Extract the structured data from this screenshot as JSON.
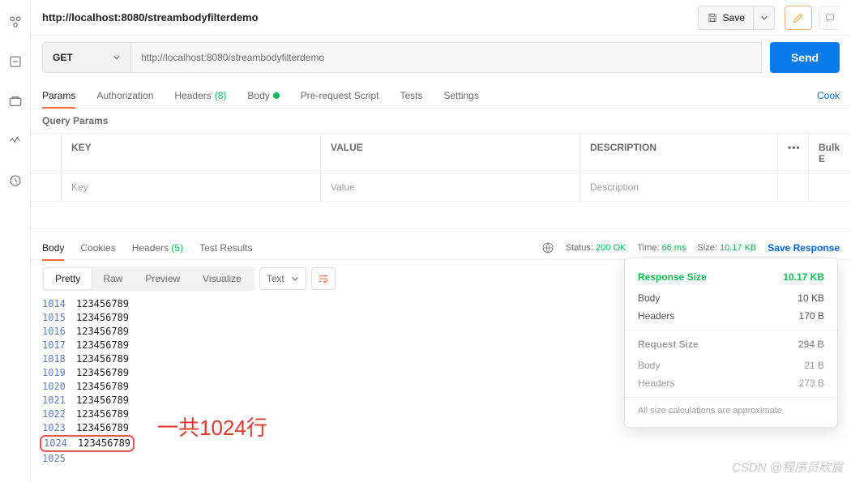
{
  "rail_icons": [
    "collections-icon",
    "api-icon",
    "env-icon",
    "monitor-icon",
    "history-icon"
  ],
  "titlebar": {
    "title": "http://localhost:8080/streambodyfilterdemo",
    "save_label": "Save"
  },
  "request": {
    "method": "GET",
    "url": "http://localhost:8080/streambodyfilterdemo",
    "send_label": "Send"
  },
  "req_tabs": {
    "params": "Params",
    "authorization": "Authorization",
    "headers": "Headers",
    "headers_count": "(8)",
    "body": "Body",
    "prerequest": "Pre-request Script",
    "tests": "Tests",
    "settings": "Settings",
    "cookies_link": "Cook"
  },
  "query_section": {
    "title": "Query Params",
    "col_key": "KEY",
    "col_value": "VALUE",
    "col_desc": "DESCRIPTION",
    "bulk": "Bulk E",
    "ph_key": "Key",
    "ph_value": "Value",
    "ph_desc": "Description"
  },
  "resp_tabs": {
    "body": "Body",
    "cookies": "Cookies",
    "headers": "Headers",
    "headers_count": "(5)",
    "tests": "Test Results"
  },
  "status_bar": {
    "status_label": "Status:",
    "status_value": "200 OK",
    "time_label": "Time:",
    "time_value": "66 ms",
    "size_label": "Size:",
    "size_value": "10.17 KB",
    "save_response": "Save Response"
  },
  "view_modes": {
    "pretty": "Pretty",
    "raw": "Raw",
    "preview": "Preview",
    "visualize": "Visualize",
    "format": "Text"
  },
  "body_lines": [
    {
      "n": "1014",
      "v": "123456789"
    },
    {
      "n": "1015",
      "v": "123456789"
    },
    {
      "n": "1016",
      "v": "123456789"
    },
    {
      "n": "1017",
      "v": "123456789"
    },
    {
      "n": "1018",
      "v": "123456789"
    },
    {
      "n": "1019",
      "v": "123456789"
    },
    {
      "n": "1020",
      "v": "123456789"
    },
    {
      "n": "1021",
      "v": "123456789"
    },
    {
      "n": "1022",
      "v": "123456789"
    },
    {
      "n": "1023",
      "v": "123456789"
    },
    {
      "n": "1024",
      "v": "123456789",
      "hl": true
    },
    {
      "n": "1025",
      "v": ""
    }
  ],
  "tooltip": {
    "resp_title": "Response Size",
    "resp_total": "10.17 KB",
    "resp_body_l": "Body",
    "resp_body_v": "10 KB",
    "resp_head_l": "Headers",
    "resp_head_v": "170 B",
    "req_title": "Request Size",
    "req_total": "294 B",
    "req_body_l": "Body",
    "req_body_v": "21 B",
    "req_head_l": "Headers",
    "req_head_v": "273 B",
    "foot": "All size calculations are approximate"
  },
  "annotation": "一共1024行",
  "watermark": "CSDN @程序员欣宸"
}
